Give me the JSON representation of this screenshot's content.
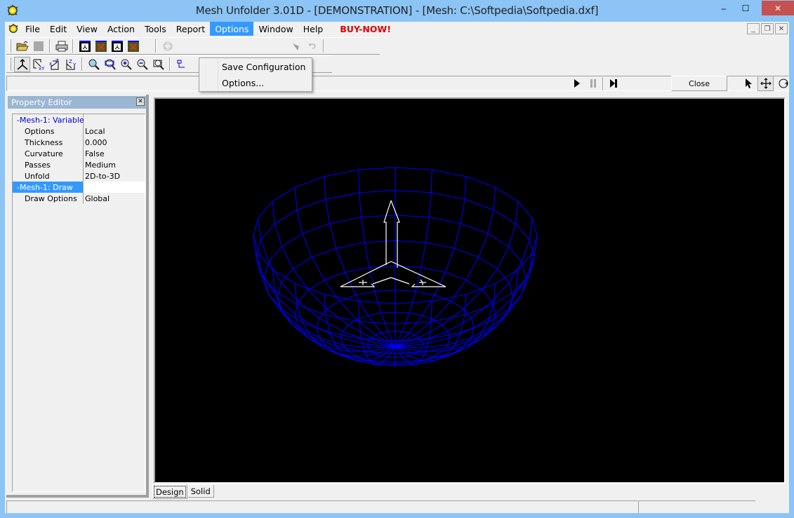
{
  "window": {
    "title": "Mesh Unfolder 3.01D - [DEMONSTRATION] - [Mesh: C:\\Softpedia\\Softpedia.dxf]",
    "controls": {
      "minimize": "–",
      "maximize": "☐",
      "close": "✕"
    },
    "accent_color": "#8cc4f5"
  },
  "menubar": {
    "items": [
      {
        "label": "File"
      },
      {
        "label": "Edit"
      },
      {
        "label": "View"
      },
      {
        "label": "Action"
      },
      {
        "label": "Tools"
      },
      {
        "label": "Report"
      },
      {
        "label": "Options",
        "active": true
      },
      {
        "label": "Window"
      },
      {
        "label": "Help"
      }
    ],
    "buy_now": "BUY-NOW!",
    "mdi_controls": {
      "minimize": "_",
      "restore": "❐",
      "close": "✕"
    }
  },
  "options_menu": {
    "items": [
      {
        "label": "Save Configuration"
      },
      {
        "label": "Options..."
      }
    ]
  },
  "toolbar1": {
    "buttons": [
      "open-folder-icon",
      "save-icon",
      "print-icon",
      "export-2d-icon",
      "export-2d-red-icon",
      "export-3d-icon",
      "export-3d-red-icon"
    ]
  },
  "toolbar2": {
    "buttons": [
      "view-axes-icon",
      "view-xy-icon",
      "view-xz-icon",
      "view-zy-icon",
      "zoom-icon",
      "zoom-window-icon",
      "zoom-in-icon",
      "zoom-out-icon",
      "zoom-extents-icon"
    ]
  },
  "command_bar": {
    "input_value": "",
    "close_label": "Close"
  },
  "property_editor": {
    "title": "Property Editor",
    "rows": [
      {
        "key": "-Mesh-1: Variable",
        "value": "",
        "group": true
      },
      {
        "key": "Options",
        "value": "Local"
      },
      {
        "key": "Thickness",
        "value": "0.000"
      },
      {
        "key": "Curvature",
        "value": "False"
      },
      {
        "key": "Passes",
        "value": "Medium"
      },
      {
        "key": "Unfold",
        "value": "2D-to-3D"
      },
      {
        "key": "-Mesh-1: Draw",
        "value": "",
        "group": true,
        "selected": true
      },
      {
        "key": "Draw Options",
        "value": "Global"
      }
    ]
  },
  "viewport": {
    "background": "#000000",
    "mesh_color": "#0000ff",
    "gizmo_color": "#ffffff",
    "mesh": {
      "type": "hemisphere",
      "meridians": 24,
      "parallels": 8
    }
  },
  "tabs": [
    {
      "label": "Design",
      "active": true
    },
    {
      "label": "Solid"
    }
  ],
  "statusbar": {
    "pane1": "",
    "pane2": ""
  }
}
